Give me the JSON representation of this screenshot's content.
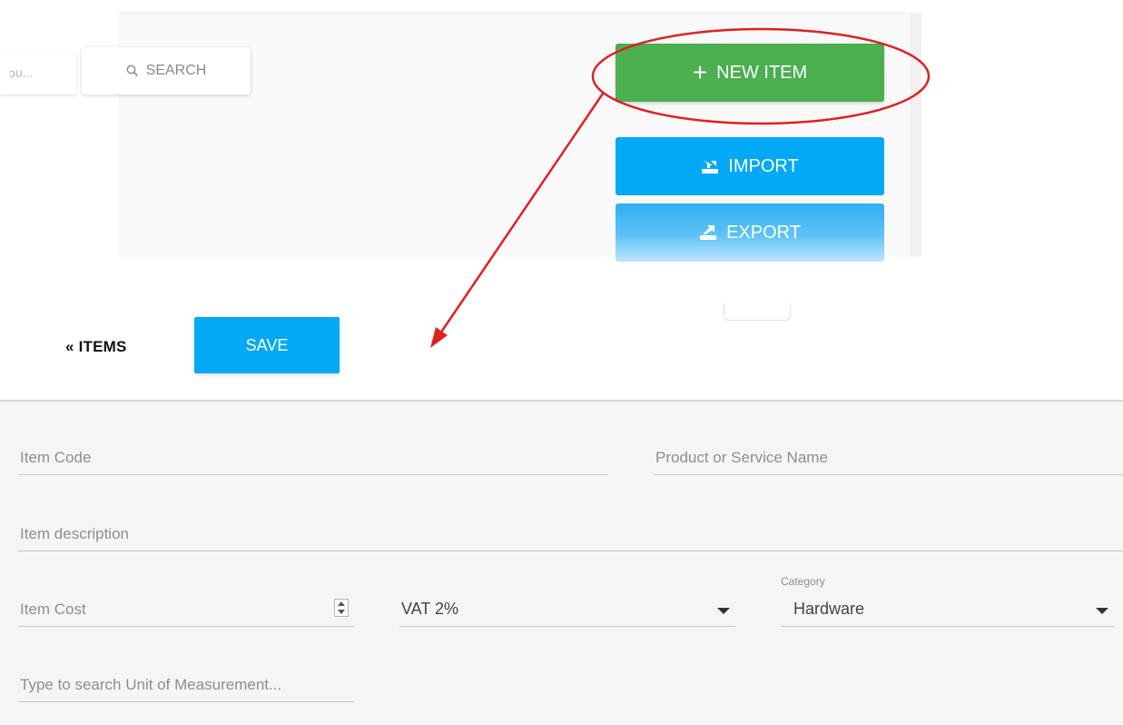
{
  "toolbar": {
    "search_input_partial": "ɔᴜ...",
    "search_label": "SEARCH",
    "new_item_label": "NEW ITEM",
    "import_label": "IMPORT",
    "export_label": "EXPORT"
  },
  "header": {
    "back_link": "« ITEMS",
    "save_label": "SAVE"
  },
  "form": {
    "item_code_placeholder": "Item Code",
    "product_name_placeholder": "Product or Service Name",
    "description_placeholder": "Item description",
    "item_cost_placeholder": "Item Cost",
    "vat_value": "VAT 2%",
    "category_label": "Category",
    "category_value": "Hardware",
    "unit_placeholder": "Type to search Unit of Measurement..."
  },
  "colors": {
    "new_item": "#4caf50",
    "primary_blue": "#03a9f4",
    "annotation_red": "#e02020"
  }
}
